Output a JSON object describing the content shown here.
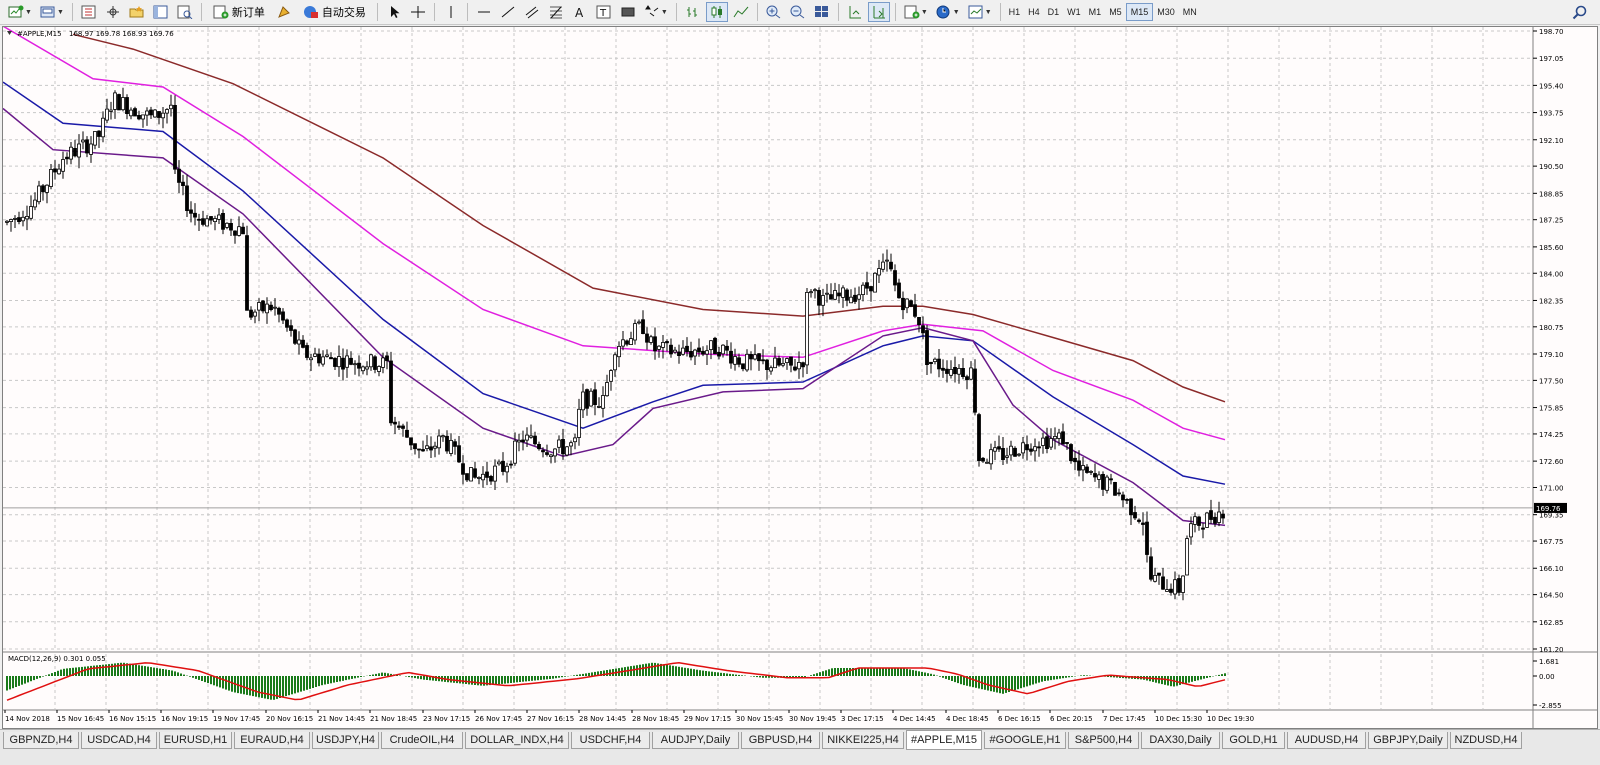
{
  "toolbar": {
    "new_order_label": "新订单",
    "auto_trade_label": "自动交易",
    "timeframes": [
      "H1",
      "H4",
      "D1",
      "W1",
      "M1",
      "M5",
      "M15",
      "M30",
      "MN"
    ],
    "active_timeframe": "M15"
  },
  "chart": {
    "symbol_info": "#APPLE,M15",
    "ohlc_info": "168.97 169.78 168.93 169.76",
    "current_price": "169.76",
    "price_levels": [
      "198.70",
      "197.05",
      "195.40",
      "193.75",
      "192.10",
      "190.50",
      "188.85",
      "187.25",
      "185.60",
      "184.00",
      "182.35",
      "180.75",
      "179.10",
      "177.50",
      "175.85",
      "174.25",
      "172.60",
      "171.00",
      "169.35",
      "167.75",
      "166.10",
      "164.50",
      "162.85",
      "161.20"
    ],
    "date_labels": [
      "14 Nov 2018",
      "15 Nov 16:45",
      "16 Nov 15:15",
      "16 Nov 19:15",
      "19 Nov 17:45",
      "20 Nov 16:15",
      "21 Nov 14:45",
      "21 Nov 18:45",
      "23 Nov 17:15",
      "26 Nov 17:45",
      "27 Nov 16:15",
      "28 Nov 14:45",
      "28 Nov 18:45",
      "29 Nov 17:15",
      "30 Nov 15:45",
      "30 Nov 19:45",
      "3 Dec 17:15",
      "4 Dec 14:45",
      "4 Dec 18:45",
      "6 Dec 16:15",
      "6 Dec 20:15",
      "7 Dec 17:45",
      "10 Dec 15:30",
      "10 Dec 19:30"
    ],
    "y_range": [
      161.2,
      198.7
    ],
    "line_colors": {
      "ma_red": "#8b2a2a",
      "ma_magenta": "#e020e0",
      "ma_blue": "#1a1aa8",
      "ma_purple": "#6a1a8a",
      "candle": "#000000"
    }
  },
  "macd": {
    "label": "MACD(12,26,9) 0.301 0.055",
    "levels": [
      "1.681",
      "0.00",
      "-2.855"
    ],
    "hist_color": "#1a7a1a",
    "signal_color": "#e01010"
  },
  "tabs": [
    "GBPNZD,H4",
    "USDCAD,H4",
    "EURUSD,H1",
    "EURAUD,H4",
    "USDJPY,H4",
    "CrudeOIL,H4",
    "DOLLAR_INDX,H4",
    "USDCHF,H4",
    "AUDJPY,Daily",
    "GBPUSD,H4",
    "NIKKEI225,H4",
    "#APPLE,M15",
    "#GOOGLE,H1",
    "S&P500,H4",
    "DAX30,Daily",
    "GOLD,H1",
    "AUDUSD,H4",
    "GBPJPY,Daily",
    "NZDUSD,H4"
  ],
  "active_tab": "#APPLE,M15"
}
